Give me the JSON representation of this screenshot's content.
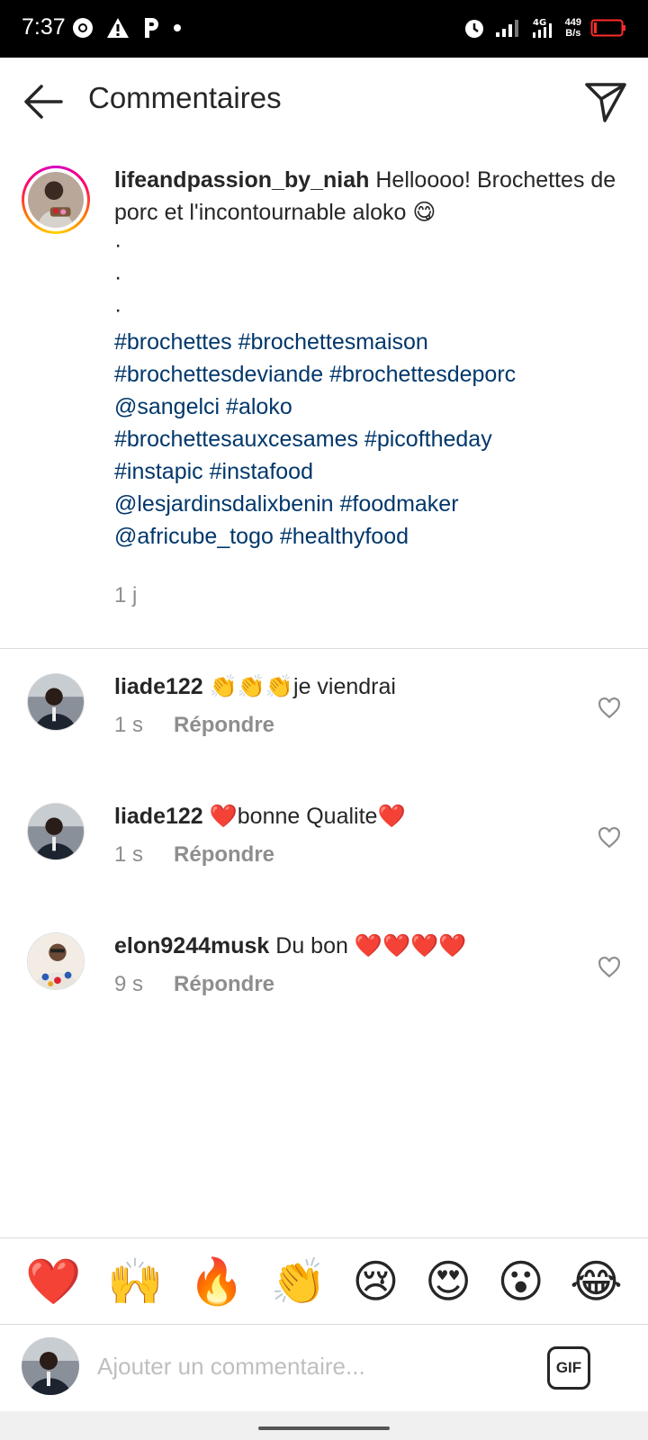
{
  "status_bar": {
    "time": "7:37",
    "net_speed_value": "449",
    "net_speed_unit": "B/s",
    "network_type": "4G"
  },
  "header": {
    "title": "Commentaires"
  },
  "caption": {
    "username": "lifeandpassion_by_niah",
    "text_line1": " Helloooo! Brochettes de porc et l'incontournable aloko 😋",
    "dots": [
      "·",
      "·",
      "·"
    ],
    "tags_line1": "#brochettes #brochettesmaison",
    "tags_line2": "#brochettesdeviande #brochettesdeporc",
    "tags_line3": "@sangelci #aloko",
    "tags_line4": "#brochettesauxcesames  #picoftheday",
    "tags_line5": "#instapic #instafood",
    "tags_line6": "@lesjardinsdalixbenin #foodmaker",
    "tags_line7": "@africube_togo #healthyfood",
    "time": "1 j"
  },
  "comments": [
    {
      "username": "liade122",
      "text": " 👏👏👏je viendrai",
      "time": "1 s",
      "reply": "Répondre"
    },
    {
      "username": "liade122",
      "text": " ❤️bonne Qualite❤️",
      "time": "1 s",
      "reply": "Répondre"
    },
    {
      "username": "elon9244musk",
      "text": " Du bon ❤️❤️❤️❤️",
      "time": "9 s",
      "reply": "Répondre"
    }
  ],
  "quick_reactions": [
    "❤️",
    "🙌",
    "🔥",
    "👏",
    "😢",
    "😍",
    "😮",
    "😂"
  ],
  "input": {
    "placeholder": "Ajouter un commentaire...",
    "gif_label": "GIF"
  },
  "colors": {
    "hashtag": "#00376b",
    "secondary_text": "#8e8e8e",
    "divider": "#dbdbdb"
  }
}
